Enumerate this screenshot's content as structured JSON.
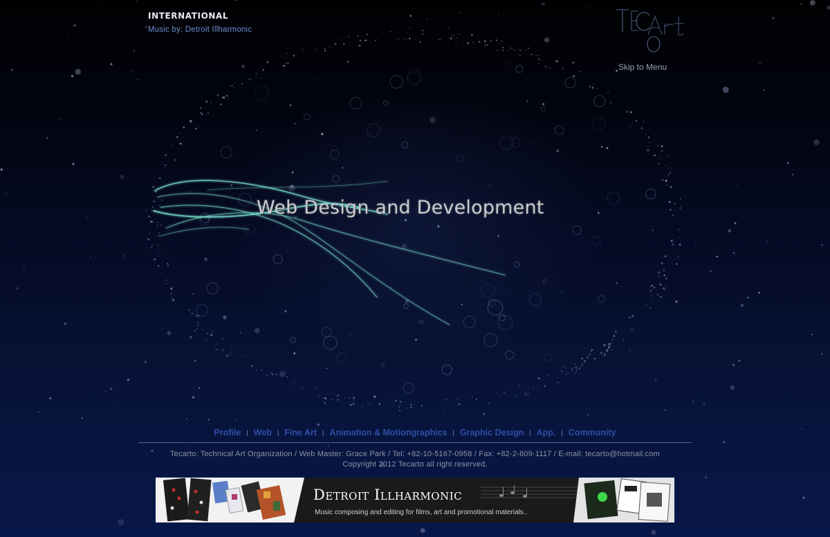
{
  "intro": {
    "title": "International",
    "music_credit": "Music by: Detroit Illharmonic"
  },
  "logo": {
    "alt_text": "TECArt",
    "skip_label": "Skip to Menu"
  },
  "hero": {
    "title": "Web Design and Development"
  },
  "nav": {
    "items": [
      {
        "label": "Profile"
      },
      {
        "label": "Web"
      },
      {
        "label": "Fine Art"
      },
      {
        "label": "Animation & Motiongraphics"
      },
      {
        "label": "Graphic Design"
      },
      {
        "label": "App."
      },
      {
        "label": "Community"
      }
    ],
    "separator": "|"
  },
  "footer": {
    "info_line": "Tecarto: Technical Art Organization / Web Master: Grace Park / Tel: +82-10-5167-0958 / Fax: +82-2-809-1117 / E-mail: tecarto@hotmail.com",
    "copyright": "Copyright 2012 Tecarto all right reserved."
  },
  "banner": {
    "title": "Detroit Illharmonic",
    "description": "Music composing and editing for films, art and promotional materials.."
  },
  "colors": {
    "nav_link": "#2e4fa6",
    "background_top": "#010103",
    "background_bottom": "#08174a",
    "music_credit": "#6a8fd0",
    "swoosh": "#7de8d4"
  }
}
